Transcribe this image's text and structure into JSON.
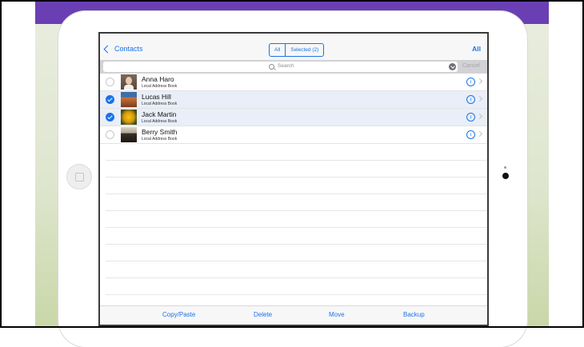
{
  "navbar": {
    "back_label": "Contacts",
    "segment_all": "All",
    "segment_selected": "Selected (2)",
    "right_label": "All"
  },
  "search": {
    "placeholder": "Search",
    "cancel_label": "Cancel"
  },
  "contacts": [
    {
      "name": "Anna Haro",
      "source": "Local Address Book",
      "selected": false
    },
    {
      "name": "Lucas Hill",
      "source": "Local Address Book",
      "selected": true
    },
    {
      "name": "Jack Martin",
      "source": "Local Address Book",
      "selected": true
    },
    {
      "name": "Berry Smith",
      "source": "Local Address Book",
      "selected": false
    }
  ],
  "toolbar": {
    "copy_paste": "Copy/Paste",
    "delete": "Delete",
    "move": "Move",
    "backup": "Backup"
  },
  "icons": {
    "info": "i",
    "accent_color": "#1a73e8",
    "frame_purple": "#6a3fb3"
  }
}
